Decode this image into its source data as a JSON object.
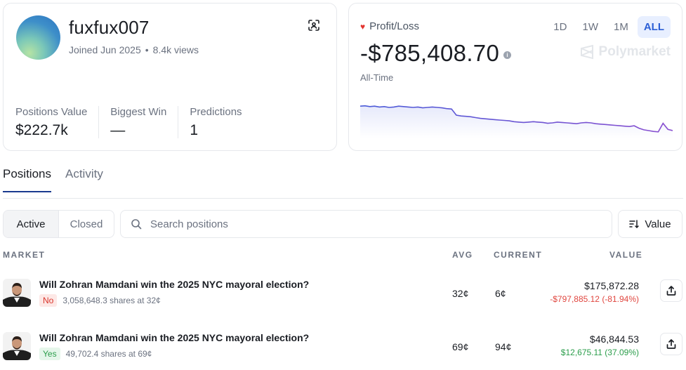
{
  "profile": {
    "username": "fuxfux007",
    "joined": "Joined Jun 2025",
    "views": "8.4k views",
    "stats": [
      {
        "label": "Positions Value",
        "value": "$222.7k"
      },
      {
        "label": "Biggest Win",
        "value": "—"
      },
      {
        "label": "Predictions",
        "value": "1"
      }
    ]
  },
  "pnl": {
    "label": "Profit/Loss",
    "value": "-$785,408.70",
    "period_label": "All-Time",
    "ranges": [
      "1D",
      "1W",
      "1M",
      "ALL"
    ],
    "active_range": "ALL",
    "brand": "Polymarket",
    "colors": {
      "line": "#4a5bd8",
      "line_end": "#8a4fd0",
      "fill": "#e6e9fb"
    },
    "series": [
      0.72,
      0.73,
      0.71,
      0.72,
      0.7,
      0.71,
      0.69,
      0.7,
      0.72,
      0.71,
      0.7,
      0.69,
      0.7,
      0.68,
      0.69,
      0.7,
      0.69,
      0.68,
      0.66,
      0.65,
      0.5,
      0.48,
      0.47,
      0.46,
      0.44,
      0.42,
      0.41,
      0.4,
      0.39,
      0.38,
      0.37,
      0.36,
      0.34,
      0.33,
      0.32,
      0.33,
      0.34,
      0.33,
      0.32,
      0.3,
      0.31,
      0.33,
      0.32,
      0.31,
      0.3,
      0.29,
      0.31,
      0.32,
      0.31,
      0.29,
      0.28,
      0.27,
      0.26,
      0.25,
      0.24,
      0.23,
      0.22,
      0.24,
      0.18,
      0.14,
      0.12,
      0.1,
      0.09,
      0.3,
      0.15,
      0.12
    ]
  },
  "tabs": [
    {
      "label": "Positions",
      "active": true
    },
    {
      "label": "Activity",
      "active": false
    }
  ],
  "filter": {
    "segments": [
      "Active",
      "Closed"
    ],
    "search_placeholder": "Search positions",
    "sort_label": "Value"
  },
  "table": {
    "headers": {
      "market": "MARKET",
      "avg": "AVG",
      "current": "CURRENT",
      "value": "VALUE"
    },
    "rows": [
      {
        "title": "Will Zohran Mamdani win the 2025 NYC mayoral election?",
        "outcome": "No",
        "shares": "3,058,648.3 shares at 32¢",
        "avg": "32¢",
        "current": "6¢",
        "value": "$175,872.28",
        "change": "-$797,885.12 (-81.94%)"
      },
      {
        "title": "Will Zohran Mamdani win the 2025 NYC mayoral election?",
        "outcome": "Yes",
        "shares": "49,702.4 shares at 69¢",
        "avg": "69¢",
        "current": "94¢",
        "value": "$46,844.53",
        "change": "$12,675.11 (37.09%)"
      }
    ]
  }
}
